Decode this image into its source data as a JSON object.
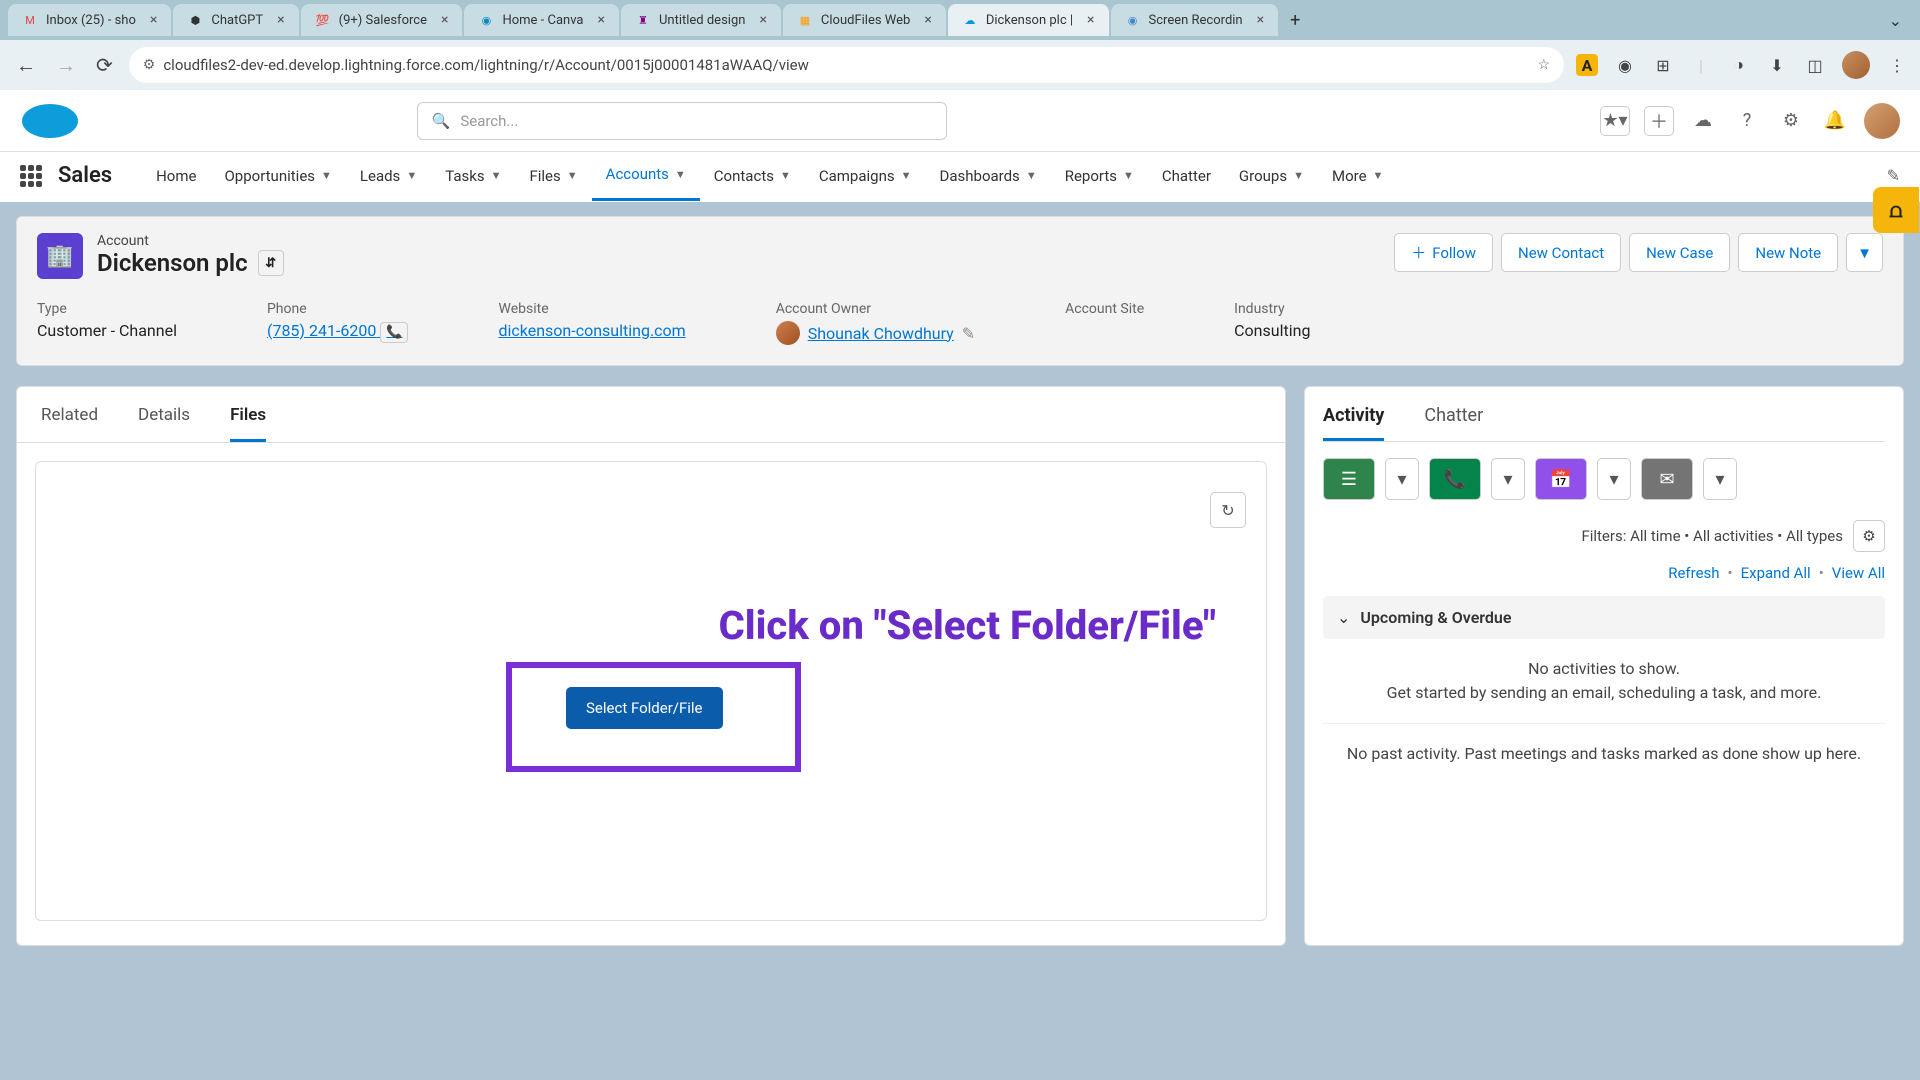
{
  "browserTabs": [
    {
      "label": "Inbox (25) - sho",
      "favicon": "M",
      "fc": "#d44"
    },
    {
      "label": "ChatGPT",
      "favicon": "⬢",
      "fc": "#333"
    },
    {
      "label": "(9+) Salesforce",
      "favicon": "💯",
      "fc": "#000"
    },
    {
      "label": "Home - Canva",
      "favicon": "◉",
      "fc": "#18b"
    },
    {
      "label": "Untitled design",
      "favicon": "♜",
      "fc": "#808"
    },
    {
      "label": "CloudFiles Web",
      "favicon": "▦",
      "fc": "#f90"
    },
    {
      "label": "Dickenson plc |",
      "favicon": "☁",
      "fc": "#09d",
      "active": true
    },
    {
      "label": "Screen Recordin",
      "favicon": "◉",
      "fc": "#48c"
    }
  ],
  "url": "cloudfiles2-dev-ed.develop.lightning.force.com/lightning/r/Account/0015j00001481aWAAQ/view",
  "search": {
    "placeholder": "Search..."
  },
  "appName": "Sales",
  "navItems": [
    {
      "label": "Home",
      "drop": false
    },
    {
      "label": "Opportunities",
      "drop": true
    },
    {
      "label": "Leads",
      "drop": true
    },
    {
      "label": "Tasks",
      "drop": true
    },
    {
      "label": "Files",
      "drop": true
    },
    {
      "label": "Accounts",
      "drop": true,
      "active": true
    },
    {
      "label": "Contacts",
      "drop": true
    },
    {
      "label": "Campaigns",
      "drop": true
    },
    {
      "label": "Dashboards",
      "drop": true
    },
    {
      "label": "Reports",
      "drop": true
    },
    {
      "label": "Chatter",
      "drop": false
    },
    {
      "label": "Groups",
      "drop": true
    },
    {
      "label": "More",
      "drop": true
    }
  ],
  "record": {
    "type": "Account",
    "name": "Dickenson plc",
    "actions": {
      "follow": "Follow",
      "newContact": "New Contact",
      "newCase": "New Case",
      "newNote": "New Note"
    },
    "fields": {
      "typeLabel": "Type",
      "typeVal": "Customer - Channel",
      "phoneLabel": "Phone",
      "phoneVal": "(785) 241-6200",
      "websiteLabel": "Website",
      "websiteVal": "dickenson-consulting.com",
      "ownerLabel": "Account Owner",
      "ownerVal": "Shounak Chowdhury",
      "siteLabel": "Account Site",
      "siteVal": "",
      "industryLabel": "Industry",
      "industryVal": "Consulting"
    }
  },
  "recTabs": {
    "related": "Related",
    "details": "Details",
    "files": "Files"
  },
  "selectBtn": "Select Folder/File",
  "callout": "Click on \"Select Folder/File\"",
  "activity": {
    "tabs": {
      "activity": "Activity",
      "chatter": "Chatter"
    },
    "filters": "Filters: All time • All activities • All types",
    "links": {
      "refresh": "Refresh",
      "expand": "Expand All",
      "view": "View All"
    },
    "upcomingTitle": "Upcoming & Overdue",
    "noActivities": "No activities to show.",
    "getStarted": "Get started by sending an email, scheduling a task, and more.",
    "noPast": "No past activity. Past meetings and tasks marked as done show up here."
  }
}
